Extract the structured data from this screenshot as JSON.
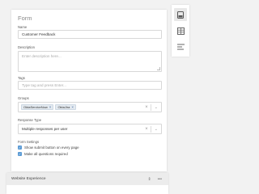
{
  "form": {
    "title": "Form",
    "name_label": "Name",
    "name_value": "Customer Feedback",
    "description_label": "Description",
    "description_placeholder": "Enter description here...",
    "tags_label": "Tags",
    "tags_placeholder": "Type tag and press Enter...",
    "groups_label": "Groups",
    "groups": [
      "OktaServiceNow",
      "OktaJira"
    ],
    "response_type_label": "Response Type",
    "response_type_value": "Multiple responses per user",
    "settings_label": "Form Settings",
    "settings": [
      {
        "label": "Show submit button on every page",
        "checked": true
      },
      {
        "label": "Make all questions required",
        "checked": true
      }
    ]
  },
  "sidebar": {
    "items": [
      {
        "icon": "panel-settings-icon",
        "active": true
      },
      {
        "icon": "table-icon",
        "active": false
      },
      {
        "icon": "text-align-icon",
        "active": false
      }
    ]
  },
  "section": {
    "title": "Website Experience",
    "icons": [
      "drag-handle-icon",
      "more-options-icon"
    ]
  },
  "colors": {
    "background": "#f2f2f2",
    "accent": "#5b9bd5",
    "chip_bg": "#e4eaf0"
  }
}
